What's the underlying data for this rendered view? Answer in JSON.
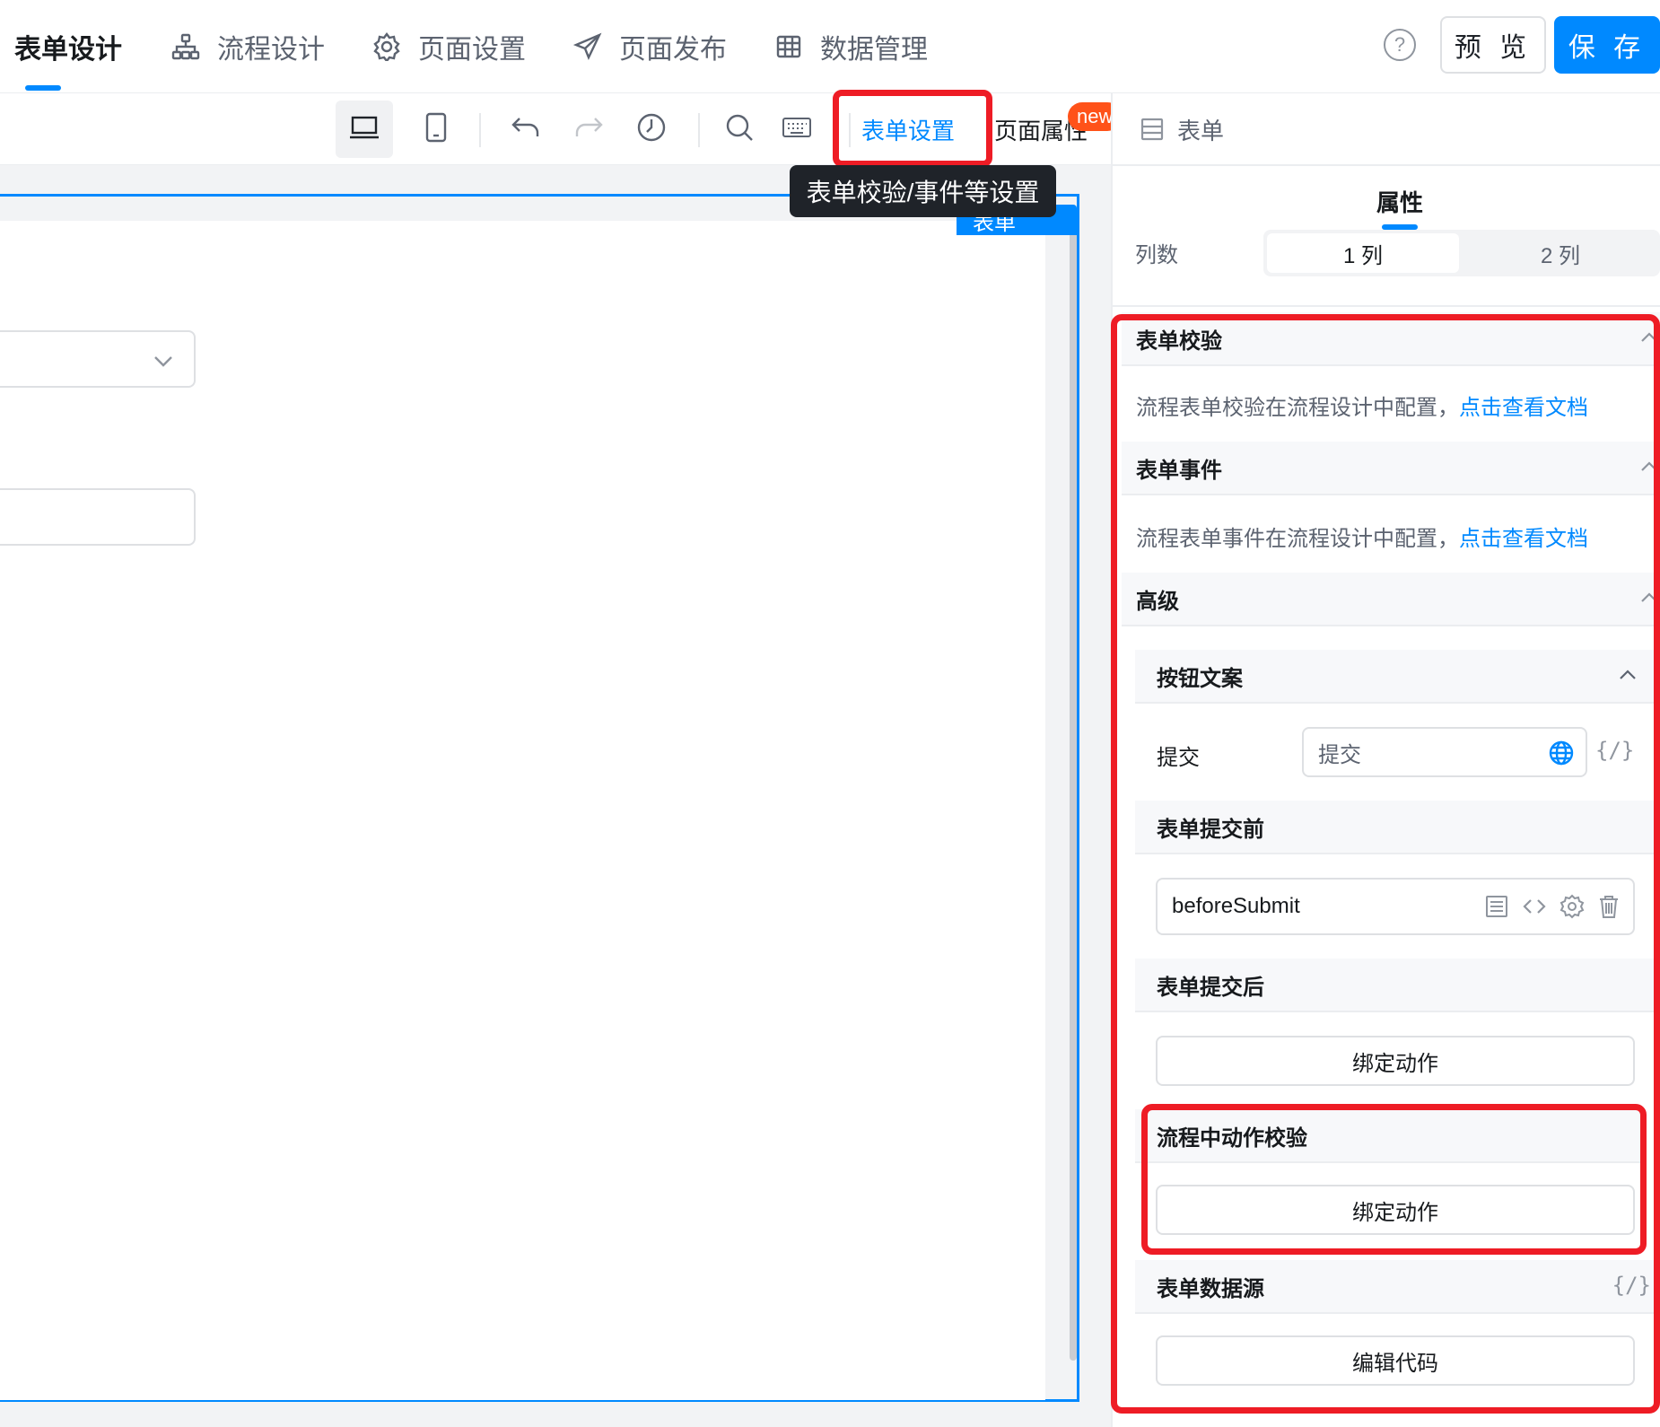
{
  "nav": {
    "tabs": [
      {
        "label": "表单设计",
        "icon": "none"
      },
      {
        "label": "流程设计",
        "icon": "flow-icon"
      },
      {
        "label": "页面设置",
        "icon": "gear-icon"
      },
      {
        "label": "页面发布",
        "icon": "send-icon"
      },
      {
        "label": "数据管理",
        "icon": "table-icon"
      }
    ],
    "help": "?",
    "preview": "预 览",
    "save": "保 存"
  },
  "toolbar": {
    "form_settings": "表单设置",
    "page_props": "页面属性",
    "new_badge": "new",
    "tooltip": "表单校验/事件等设置"
  },
  "canvas": {
    "form_tag": "表单"
  },
  "panel": {
    "header": "表单",
    "attr_tab": "属性",
    "columns_label": "列数",
    "col_options": [
      "1 列",
      "2 列"
    ],
    "validation": {
      "title": "表单校验",
      "note": "流程表单校验在流程设计中配置，",
      "link": "点击查看文档"
    },
    "events": {
      "title": "表单事件",
      "note": "流程表单事件在流程设计中配置，",
      "link": "点击查看文档"
    },
    "advanced": {
      "title": "高级",
      "button_text": "按钮文案",
      "submit_label": "提交",
      "submit_value": "提交",
      "code_brace": "{/}",
      "before_submit_title": "表单提交前",
      "before_submit_value": "beforeSubmit",
      "after_submit_title": "表单提交后",
      "bind_action": "绑定动作",
      "flow_action_title": "流程中动作校验",
      "bind_action_2": "绑定动作",
      "datasource_title": "表单数据源",
      "edit_code": "编辑代码"
    }
  },
  "colors": {
    "accent": "#0089ff",
    "highlight": "#ee1c25",
    "badge": "#ff5219"
  }
}
